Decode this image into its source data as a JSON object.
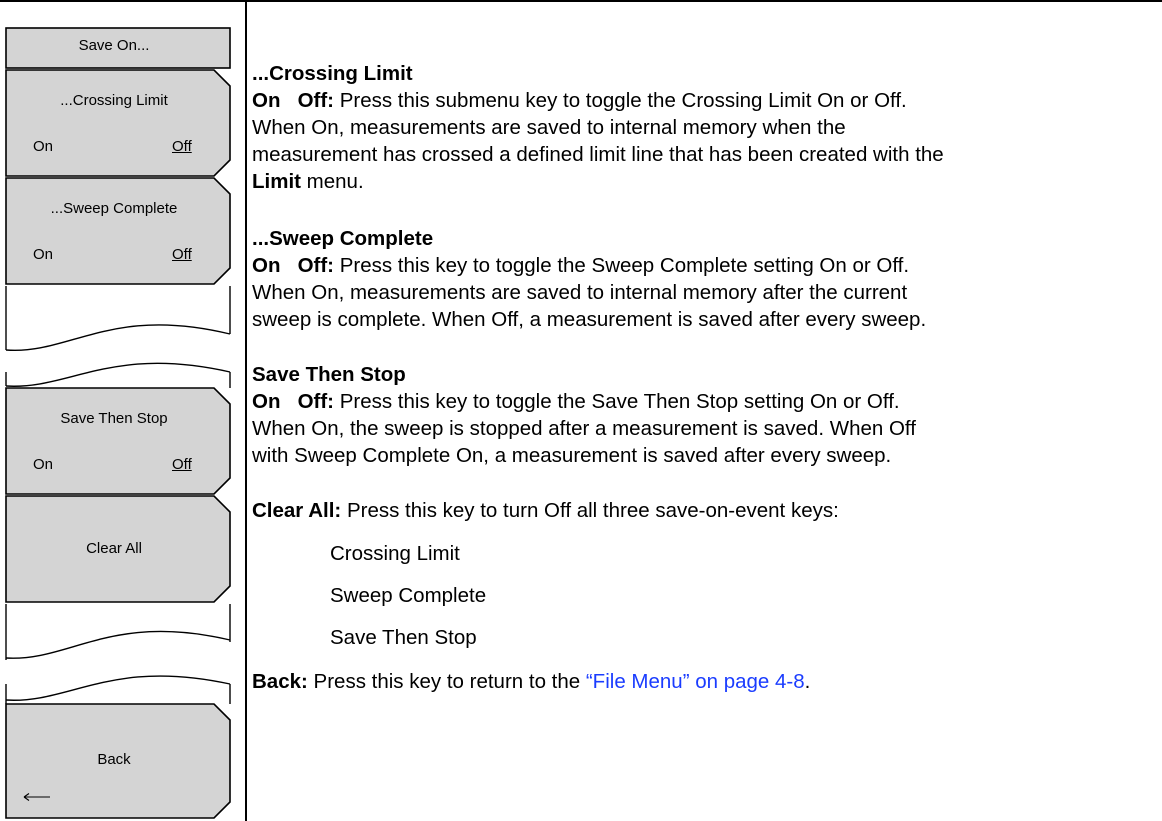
{
  "menu": {
    "title": "Save On...",
    "keys": [
      {
        "label": "...Crossing Limit",
        "on": "On",
        "off": "Off"
      },
      {
        "label": "...Sweep Complete",
        "on": "On",
        "off": "Off"
      },
      {
        "label": "Save Then Stop",
        "on": "On",
        "off": "Off"
      },
      {
        "label": "Clear All"
      },
      {
        "label": "Back"
      }
    ]
  },
  "content": {
    "crossing": {
      "heading": "...Crossing Limit",
      "onoff_on": "On",
      "onoff_off": "Off:",
      "line1": " Press this submenu key to toggle the Crossing Limit On or Off.",
      "line2": "When On, measurements are saved to internal memory when the",
      "line3": "measurement has crossed a defined limit line that has been created with the",
      "limit_word": "Limit",
      "line4": " menu."
    },
    "sweep": {
      "heading": "...Sweep Complete",
      "onoff_on": "On",
      "onoff_off": "Off:",
      "line1": " Press this key to toggle the Sweep Complete setting On or Off.",
      "line2": "When On, measurements are saved to internal memory after the current",
      "line3": "sweep is complete. When Off, a measurement is saved after every sweep."
    },
    "savestop": {
      "heading": "Save Then Stop",
      "onoff_on": "On",
      "onoff_off": "Off:",
      "line1": " Press this key to toggle the Save Then Stop setting On or Off.",
      "line2": "When On, the sweep is stopped after a measurement is saved. When Off",
      "line3": "with Sweep Complete On, a measurement is saved after every sweep."
    },
    "clearall": {
      "label": "Clear All:",
      "text": " Press this key to turn Off all three save-on-event keys:",
      "items": [
        "Crossing Limit",
        "Sweep Complete",
        "Save Then Stop"
      ]
    },
    "back": {
      "label": "Back:",
      "text": " Press this key to return to the ",
      "link": "“File Menu” on page 4-8",
      "end": "."
    }
  }
}
